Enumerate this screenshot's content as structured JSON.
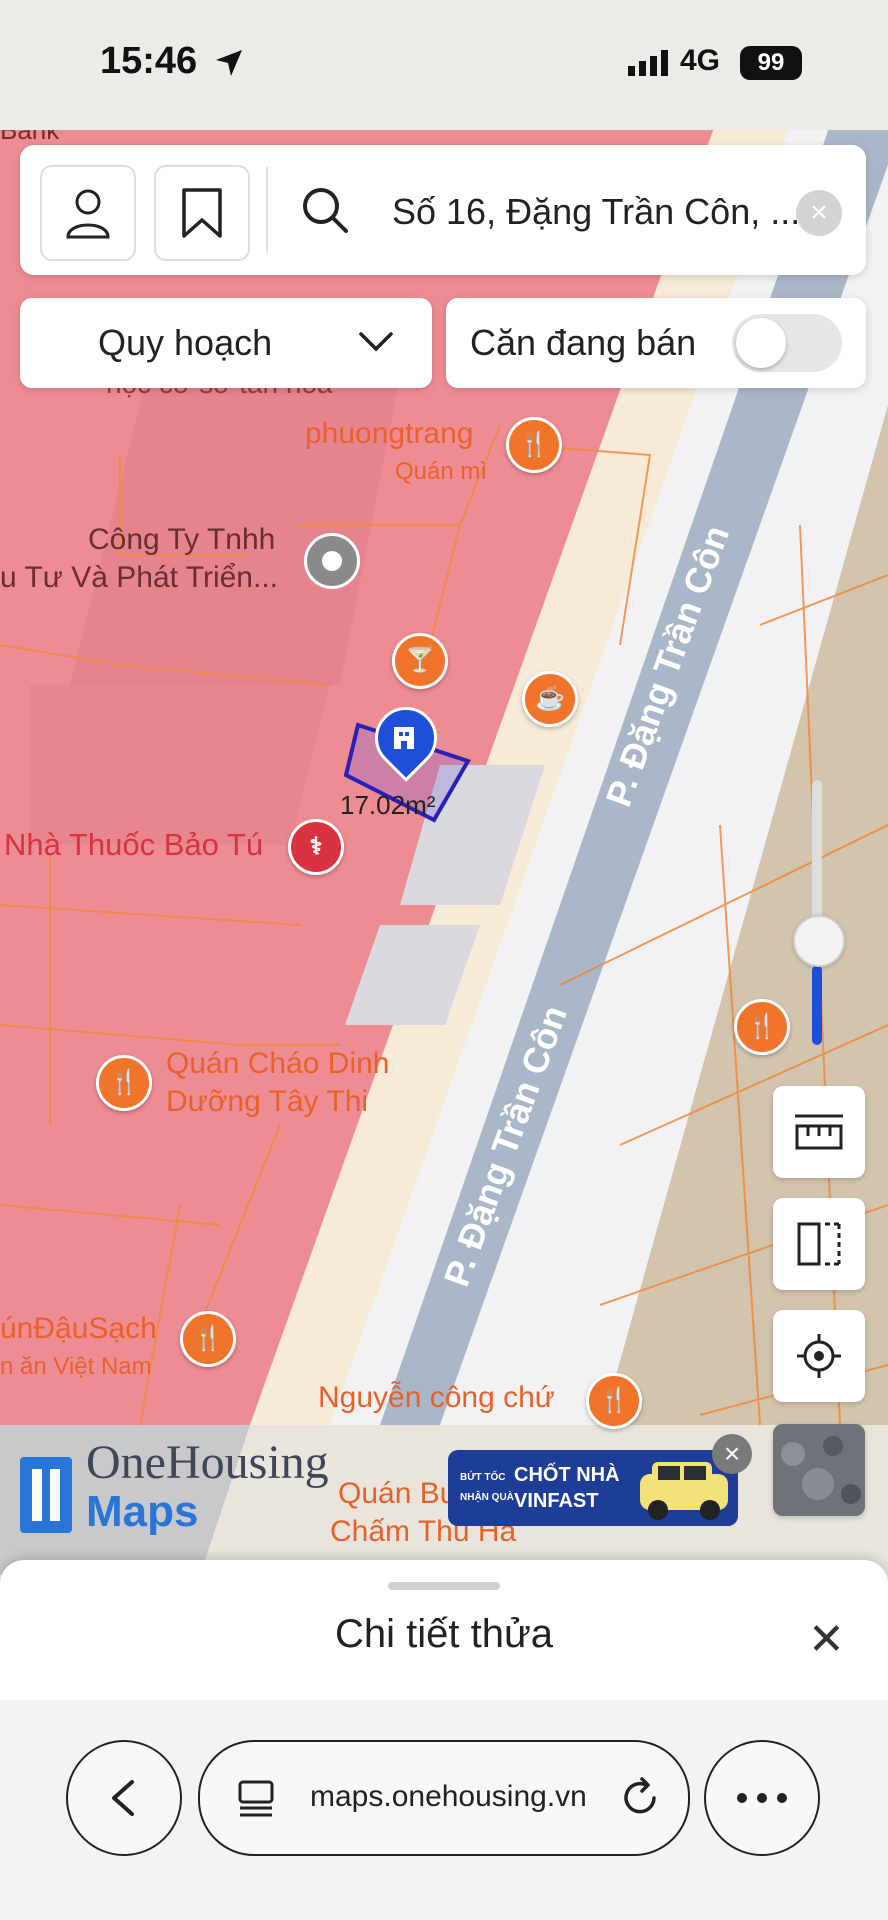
{
  "status_bar": {
    "time": "15:46",
    "network": "4G",
    "battery": "99"
  },
  "search": {
    "text": "Số 16, Đặng Trần Côn, ..."
  },
  "filters": {
    "planning_label": "Quy hoạch",
    "for_sale_label": "Căn đang bán",
    "for_sale_on": false
  },
  "map": {
    "labels": {
      "bank_partial": "Bank",
      "school_partial": "học cơ sở tân hòa",
      "phuongtrang": "phuongtrang",
      "quan_mi": "Quán mì",
      "company_l1": "Công Ty Tnhh",
      "company_l2": "u Tư Và Phát Triển...",
      "parcel_area": "17.02m²",
      "pharmacy": "Nhà Thuốc Bảo Tú",
      "chao_l1": "Quán Cháo Dinh",
      "chao_l2": "Dưỡng Tây Thi",
      "bundau_l1": "únĐậuSạch",
      "bundau_l2": "n ăn Việt Nam",
      "nguyen": "Nguyễn công chứ",
      "bun_l1": "Quán Bu",
      "bun_l2": "Chấm Thu Hà",
      "street_1": "P. Đặng Trần Côn",
      "street_2": "P. Đặng Trần Côn"
    },
    "logo": {
      "line1": "OneHousing",
      "line2": "Maps"
    },
    "banner": {
      "small_l1": "BỨT TỐC",
      "small_l2": "NHẬN QUÀ",
      "big_l1": "CHỐT NHÀ",
      "big_l2": "VINFAST"
    }
  },
  "sheet": {
    "title": "Chi tiết thửa"
  },
  "browser": {
    "url": "maps.onehousing.vn"
  },
  "colors": {
    "planning_red": "#ee8c94",
    "road_blue": "#a9b7c9",
    "accent_blue": "#1f4fd9",
    "poi_orange": "#f0752b"
  }
}
